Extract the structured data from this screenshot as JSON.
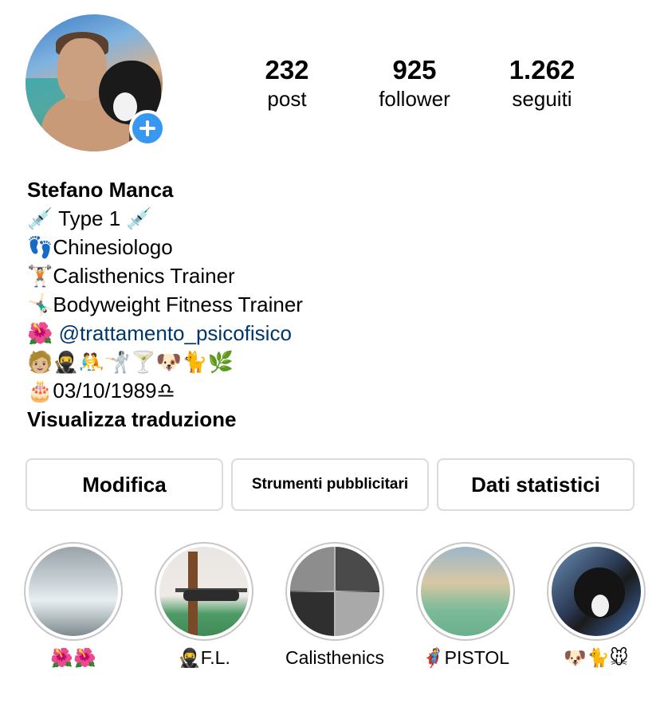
{
  "profile": {
    "stats": [
      {
        "value": "232",
        "label": "post"
      },
      {
        "value": "925",
        "label": "follower"
      },
      {
        "value": "1.262",
        "label": "seguiti"
      }
    ],
    "name": "Stefano Manca",
    "bio_lines": [
      "💉 Type 1 💉",
      "👣Chinesiologo",
      "🏋🏻Calisthenics Trainer",
      "🤸🏻‍♂️Bodyweight Fitness Trainer",
      "🌺",
      "🧑🏼🥷🤼🤺🍸🐶🐈🌿",
      "🎂03/10/1989♎"
    ],
    "bio_link": "@trattamento_psicofisico",
    "translate_label": "Visualizza traduzione"
  },
  "actions": {
    "edit_label": "Modifica",
    "ads_label": "Strumenti pubblicitari",
    "insights_label": "Dati statistici"
  },
  "highlights": [
    {
      "label": "🌺🌺"
    },
    {
      "label": "🥷F.L."
    },
    {
      "label": "Calisthenics"
    },
    {
      "label": "🦸PISTOL"
    },
    {
      "label": "🐶🐈🐭"
    }
  ],
  "colors": {
    "accent": "#3897f0",
    "link": "#00376b",
    "border": "#dbdbdb"
  }
}
